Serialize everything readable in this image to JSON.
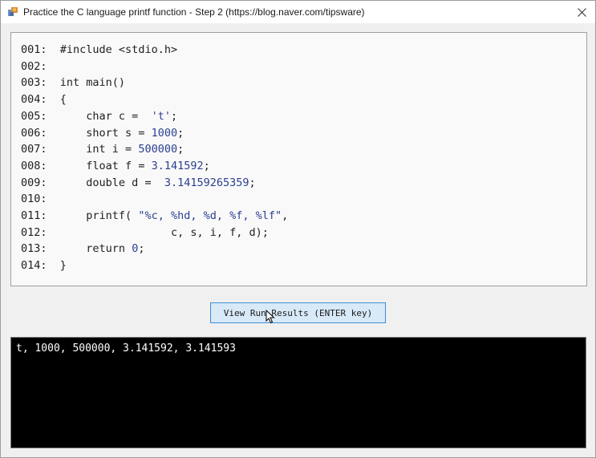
{
  "window": {
    "title": "Practice the C language printf function - Step 2 (https://blog.naver.com/tipsware)"
  },
  "code": {
    "lines": [
      {
        "num": "001:",
        "text": "#include <stdio.h>"
      },
      {
        "num": "002:",
        "text": ""
      },
      {
        "num": "003:",
        "text": "int main()"
      },
      {
        "num": "004:",
        "text": "{"
      },
      {
        "num": "005:",
        "text": "    char c =  't';"
      },
      {
        "num": "006:",
        "text": "    short s = 1000;"
      },
      {
        "num": "007:",
        "text": "    int i = 500000;"
      },
      {
        "num": "008:",
        "text": "    float f = 3.141592;"
      },
      {
        "num": "009:",
        "text": "    double d =  3.14159265359;"
      },
      {
        "num": "010:",
        "text": ""
      },
      {
        "num": "011:",
        "text": "    printf( \"%c, %hd, %d, %f, %lf\","
      },
      {
        "num": "012:",
        "text": "                 c, s, i, f, d);"
      },
      {
        "num": "013:",
        "text": "    return 0;"
      },
      {
        "num": "014:",
        "text": "}"
      }
    ]
  },
  "run_button": {
    "label": "View Run Results (ENTER key)"
  },
  "console": {
    "output": "t, 1000, 500000, 3.141592, 3.141593"
  },
  "colors": {
    "code_text": "#1f1f1f",
    "code_literal": "#2a3f8f",
    "button_bg": "#d8e9f8",
    "button_border": "#3f8fd5",
    "console_bg": "#000000",
    "console_fg": "#ffffff"
  },
  "icons": {
    "app": "app-icon",
    "close": "close-icon",
    "cursor": "mouse-pointer-icon"
  }
}
